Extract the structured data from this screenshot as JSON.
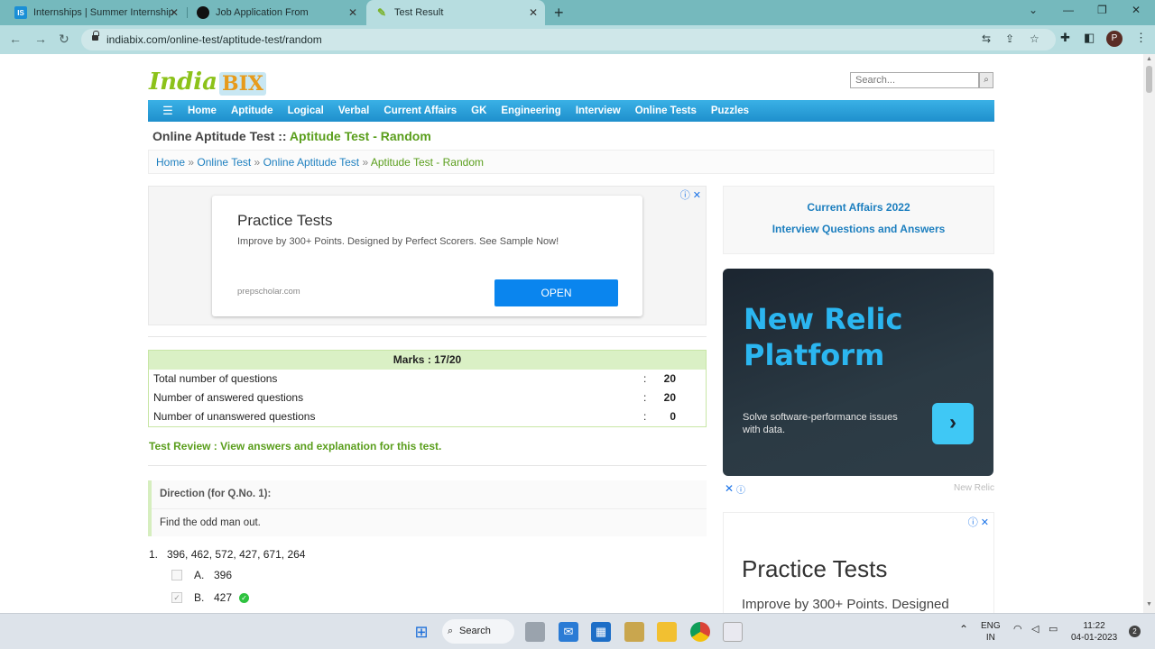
{
  "browser": {
    "tabs": [
      {
        "label": "Internships | Summer Internship",
        "favicon": "IS"
      },
      {
        "label": "Job Application From",
        "favicon": ""
      },
      {
        "label": "Test Result",
        "favicon": ""
      }
    ],
    "url": "indiabix.com/online-test/aptitude-test/random",
    "profile_initial": "P"
  },
  "site": {
    "logo_india": "India",
    "logo_bix": "BIX",
    "search_placeholder": "Search...",
    "nav": [
      "Home",
      "Aptitude",
      "Logical",
      "Verbal",
      "Current Affairs",
      "GK",
      "Engineering",
      "Interview",
      "Online Tests",
      "Puzzles"
    ]
  },
  "heading": {
    "prefix": "Online Aptitude Test :: ",
    "highlight": "Aptitude Test - Random"
  },
  "breadcrumb": {
    "items": [
      "Home",
      "Online Test",
      "Online Aptitude Test"
    ],
    "separator": "»",
    "current": "Aptitude Test - Random"
  },
  "ad_top": {
    "title": "Practice Tests",
    "text": "Improve by 300+ Points. Designed by Perfect Scorers. See Sample Now!",
    "domain": "prepscholar.com",
    "cta": "OPEN"
  },
  "result": {
    "marks_label": "Marks : 17/20",
    "rows": [
      {
        "label": "Total number of questions",
        "value": "20"
      },
      {
        "label": "Number of answered questions",
        "value": "20"
      },
      {
        "label": "Number of unanswered questions",
        "value": "0"
      }
    ],
    "colon": ":"
  },
  "review_link": "Test Review : View answers and explanation for this test.",
  "direction": {
    "heading": "Direction (for Q.No. 1):",
    "text": "Find the odd man out."
  },
  "question": {
    "number": "1.",
    "text": "396, 462, 572, 427, 671, 264",
    "options": [
      {
        "label": "A.",
        "value": "396",
        "checked": false,
        "correct": false
      },
      {
        "label": "B.",
        "value": "427",
        "checked": true,
        "correct": true
      }
    ]
  },
  "sidebar": {
    "links": [
      "Current Affairs 2022",
      "Interview Questions and Answers"
    ],
    "ad_newrelic": {
      "title": "New Relic Platform",
      "text": "Solve software-performance issues with data.",
      "brand": "New Relic"
    },
    "ad_bottom": {
      "title": "Practice Tests",
      "text": "Improve by 300+ Points. Designed"
    }
  },
  "taskbar": {
    "search_label": "Search",
    "lang_top": "ENG",
    "lang_bottom": "IN",
    "time": "11:22",
    "date": "04-01-2023",
    "notifications": "2"
  },
  "colors": {
    "nav_blue": "#2aa2dc",
    "green_accent": "#5a9e1c",
    "link_blue": "#1d7fbf",
    "browser_teal": "#75b9bd"
  }
}
